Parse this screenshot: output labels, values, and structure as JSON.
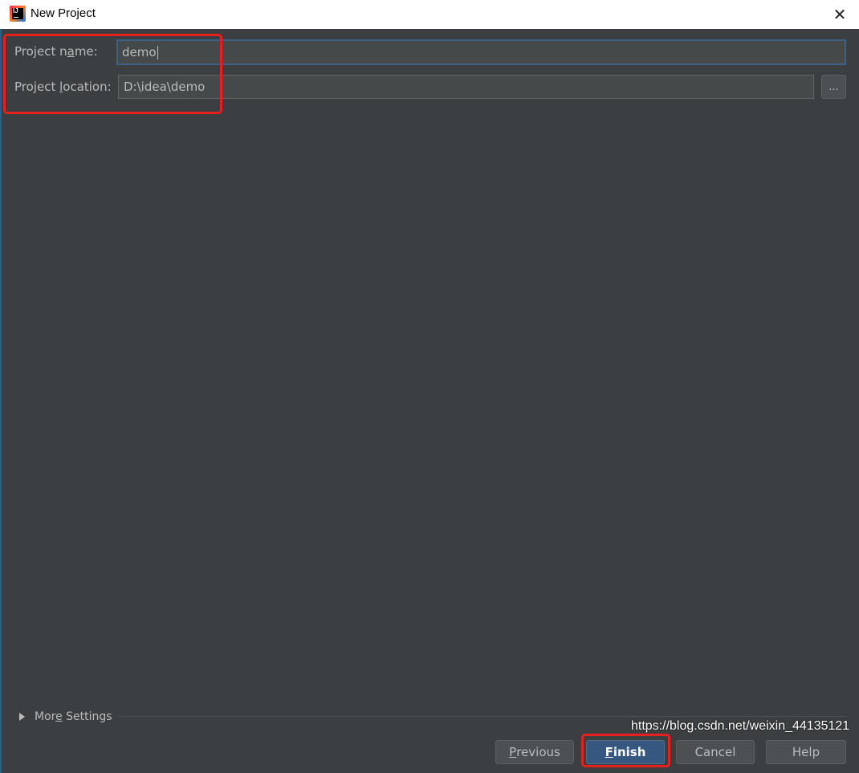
{
  "window": {
    "title": "New Project",
    "close_glyph": "✕"
  },
  "form": {
    "project_name": {
      "label_before": "Project n",
      "label_mnemonic": "a",
      "label_after": "me:",
      "value": "demo"
    },
    "project_location": {
      "label_before": "Project ",
      "label_mnemonic": "l",
      "label_after": "ocation:",
      "value": "D:\\idea\\demo",
      "browse_label": "..."
    }
  },
  "more_settings": {
    "label_before": "Mor",
    "label_mnemonic": "e",
    "label_after": " Settings"
  },
  "buttons": {
    "previous": {
      "mnemonic": "P",
      "rest": "revious"
    },
    "finish": {
      "mnemonic": "F",
      "rest": "inish"
    },
    "cancel": {
      "label": "Cancel"
    },
    "help": {
      "label": "Help"
    }
  },
  "watermark": "https://blog.csdn.net/weixin_44135121",
  "colors": {
    "background": "#3c3f41",
    "highlight": "#e8201d",
    "primary_button": "#365880"
  }
}
